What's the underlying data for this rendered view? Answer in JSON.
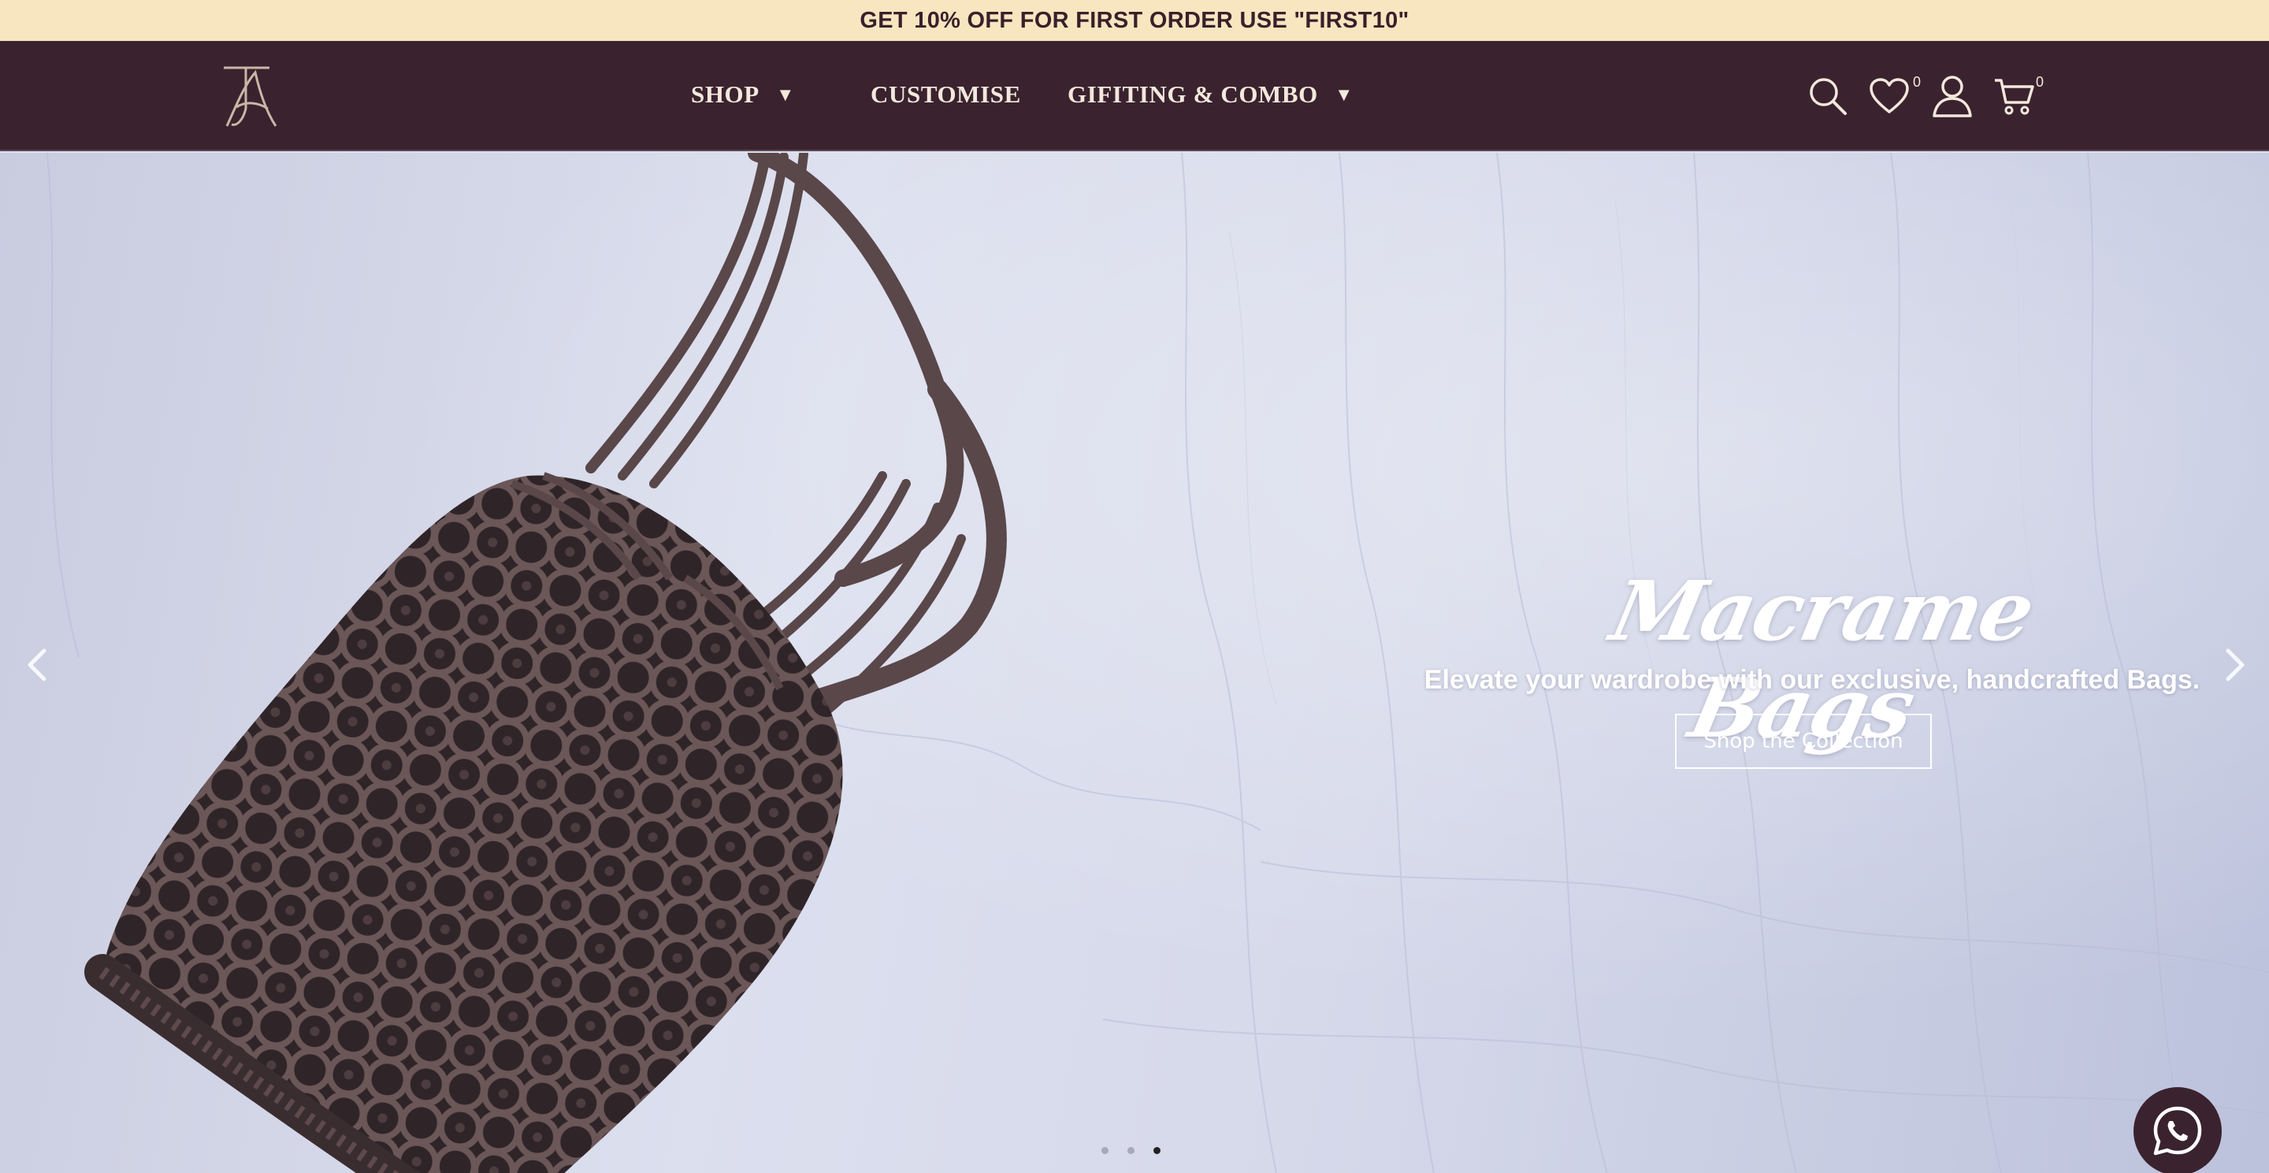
{
  "announcement": {
    "text": "GET 10% OFF FOR FIRST ORDER USE \"FIRST10\""
  },
  "brand": {
    "logo_text": "TA"
  },
  "nav": {
    "items": [
      {
        "label": "SHOP",
        "has_dropdown": true
      },
      {
        "label": "CUSTOMISE",
        "has_dropdown": false
      },
      {
        "label": "GIFITING & COMBO",
        "has_dropdown": true
      }
    ],
    "icons": {
      "search": "search-icon",
      "wishlist": "heart-icon",
      "account": "user-icon",
      "cart": "cart-icon"
    },
    "wishlist_count": "0",
    "cart_count": "0"
  },
  "hero": {
    "title": "Macrame Bags",
    "subtitle": "Elevate your wardrobe with our exclusive, handcrafted Bags.",
    "cta_label": "Shop the Collection",
    "slides_total": 3,
    "active_slide": 3
  },
  "colors": {
    "announcement_bg": "#f7e6bf",
    "nav_bg": "#3b222f",
    "nav_text": "#f2e8dc",
    "hero_text": "#ffffff"
  }
}
